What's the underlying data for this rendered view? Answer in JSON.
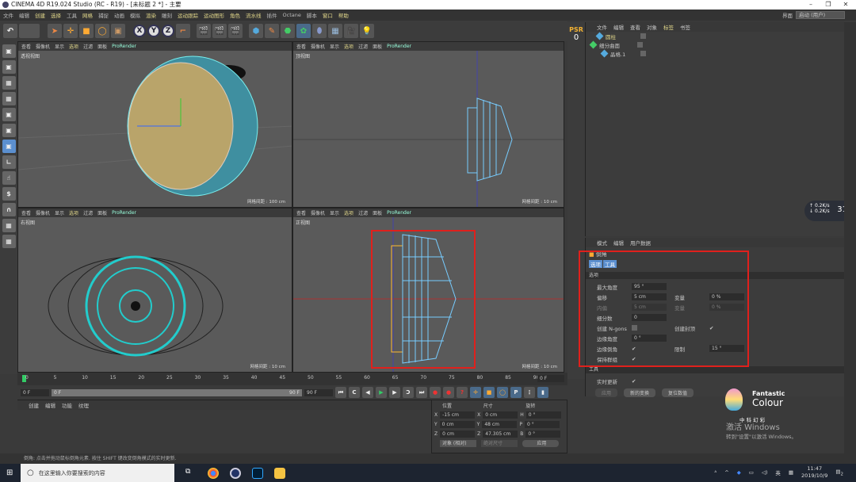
{
  "window": {
    "title": "CINEMA 4D R19.024 Studio (RC - R19) - [未标题 2 *] - 主要",
    "minimize": "–",
    "restore": "❐",
    "close": "✕"
  },
  "menu": [
    "文件",
    "编辑",
    "创建",
    "选择",
    "工具",
    "网格",
    "捕捉",
    "动画",
    "模拟",
    "渲染",
    "雕刻",
    "运动跟踪",
    "运动图形",
    "角色",
    "流水线",
    "插件",
    "Octane",
    "脚本",
    "窗口",
    "帮助"
  ],
  "layout": {
    "label": "界面",
    "value": "启动 (用户)"
  },
  "viewport_menu": [
    "查看",
    "摄像机",
    "显示",
    "选项",
    "过滤",
    "面板",
    "ProRender"
  ],
  "viewports": [
    {
      "name": "透视视图",
      "grid": "网格间距 : 100 cm"
    },
    {
      "name": "顶视图",
      "grid": "网格间距 : 10 cm"
    },
    {
      "name": "右视图",
      "grid": "网格间距 : 10 cm"
    },
    {
      "name": "正视图",
      "grid": "网格间距 : 10 cm"
    }
  ],
  "psr": {
    "label": "PSR",
    "value": "0"
  },
  "object_manager": {
    "menu": [
      "文件",
      "编辑",
      "查看",
      "对象",
      "标签",
      "书签"
    ],
    "objects": [
      {
        "name": "圆柱",
        "selected": true
      },
      {
        "name": "细分曲面"
      },
      {
        "name": "晶格.1"
      }
    ]
  },
  "attributes": {
    "menu": [
      "模式",
      "编辑",
      "用户数据"
    ],
    "tool": "倒角",
    "tabs": [
      "选项",
      "工具"
    ],
    "section": "选项",
    "fields": {
      "max_angle_label": "最大角度",
      "max_angle": "95 °",
      "offset_label": "偏移",
      "offset": "5 cm",
      "var_label": "变量",
      "var": "0 %",
      "inset_label": "内偏",
      "inset": "5 cm",
      "var2_label": "变量",
      "var2": "0 %",
      "sub_label": "细分数",
      "sub": "0",
      "ngons_label": "创建 N-gons",
      "cap_label": "创建封顶",
      "edge_angle_label": "边缘角度",
      "edge_angle": "0 °",
      "edge_round_label": "边缘倒角",
      "limit_label": "限制",
      "limit": "15 °",
      "keep_label": "保持群组"
    },
    "section2": "工具",
    "realtime_label": "实时更新",
    "buttons": [
      "应用",
      "新的变换",
      "复位数值"
    ]
  },
  "timeline": {
    "ticks": [
      "0",
      "5",
      "10",
      "15",
      "20",
      "25",
      "30",
      "35",
      "40",
      "45",
      "50",
      "55",
      "60",
      "65",
      "70",
      "75",
      "80",
      "85",
      "90"
    ],
    "current": "0 F",
    "start": "0 F",
    "range_start": "0 F",
    "range_end": "90 F",
    "end": "90 F"
  },
  "material": {
    "menu": [
      "创建",
      "编辑",
      "功能",
      "纹理"
    ]
  },
  "coords": {
    "headers": [
      "位置",
      "尺寸",
      "旋转"
    ],
    "rows": [
      [
        "X",
        "-15 cm",
        "X",
        "0 cm",
        "H",
        "0 °"
      ],
      [
        "Y",
        "0 cm",
        "Y",
        "48 cm",
        "P",
        "0 °"
      ],
      [
        "Z",
        "0 cm",
        "Z",
        "47.305 cm",
        "B",
        "0 °"
      ]
    ],
    "mode": "对象 (相对)",
    "size_mode": "绝对尺寸",
    "apply": "应用"
  },
  "status": "倒角: 点击并拖动鼠标倒角元素. 按住 SHIFT 键改变倒角模式的实时更新.",
  "speed": {
    "up": "0.2",
    "down": "0.2",
    "unit": "K/s",
    "pct": "31"
  },
  "logo": {
    "brand1": "Fantastic",
    "brand2": "Colour",
    "cn": "中 科 幻 彩"
  },
  "activation": {
    "title": "激活 Windows",
    "sub": "转到\"设置\"以激活 Windows。"
  },
  "taskbar": {
    "search": "在这里输入你要搜索的内容",
    "time": "11:47",
    "date": "2019/10/9",
    "ime": "英",
    "notif": "2"
  },
  "colors": {
    "accent_yellow": "#e0d68a",
    "selection_blue": "#5b8fcf",
    "highlight_red": "#e0201c"
  }
}
